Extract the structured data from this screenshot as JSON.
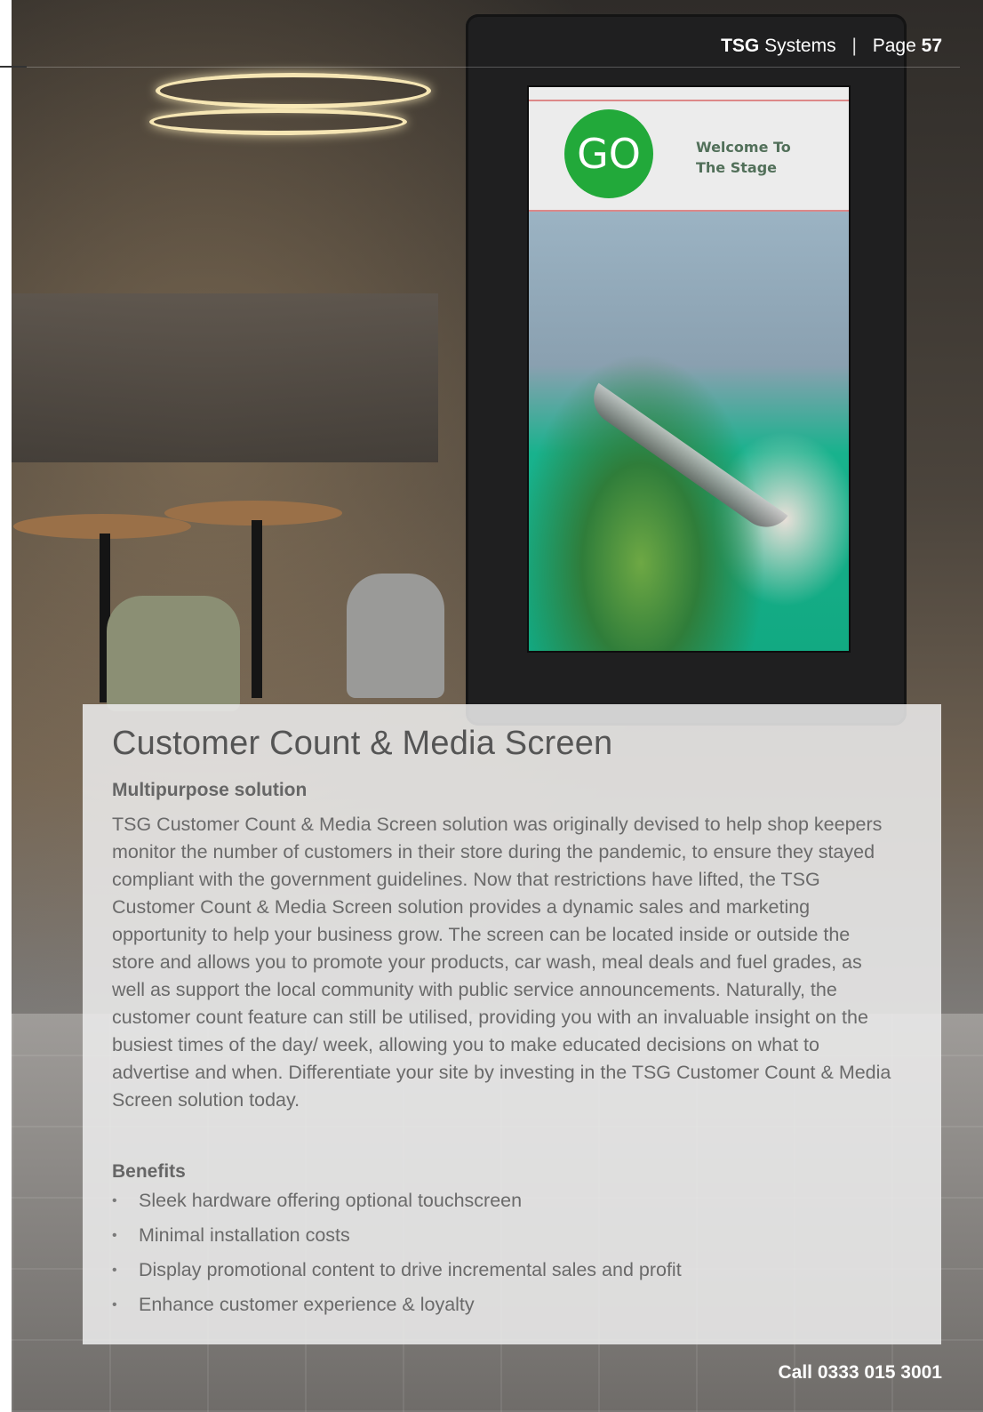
{
  "header": {
    "brand_bold": "TSG",
    "brand_rest": "Systems",
    "separator": "|",
    "page_label": "Page",
    "page_number": "57"
  },
  "kiosk_screen": {
    "logo_text": "GO",
    "welcome_line1": "Welcome To",
    "welcome_line2": "The Stage"
  },
  "content": {
    "title": "Customer Count & Media Screen",
    "subheading": "Multipurpose solution",
    "body": "TSG Customer Count & Media Screen solution was originally devised to help shop keepers monitor the number of customers in their store during the pandemic, to ensure they stayed compliant with the government guidelines. Now that restrictions have lifted, the TSG Customer Count & Media Screen solution provides a dynamic sales and marketing opportunity to help your business grow. The screen can be located inside or outside the store and allows you to promote your products, car wash, meal deals and fuel grades, as well as support the local community with public service announcements. Naturally, the customer count feature can still be utilised, providing you with an invaluable insight on the busiest times of the day/ week, allowing you to make educated decisions on what to advertise and when. Differentiate your site by investing in the TSG Customer Count & Media Screen solution today.",
    "benefits_heading": "Benefits",
    "bullet_symbol": "•",
    "benefits": [
      "Sleek hardware offering optional touchscreen",
      "Minimal installation costs",
      "Display promotional content to drive incremental sales and profit",
      "Enhance customer experience & loyalty"
    ]
  },
  "footer": {
    "call": "Call 0333 015 3001"
  }
}
